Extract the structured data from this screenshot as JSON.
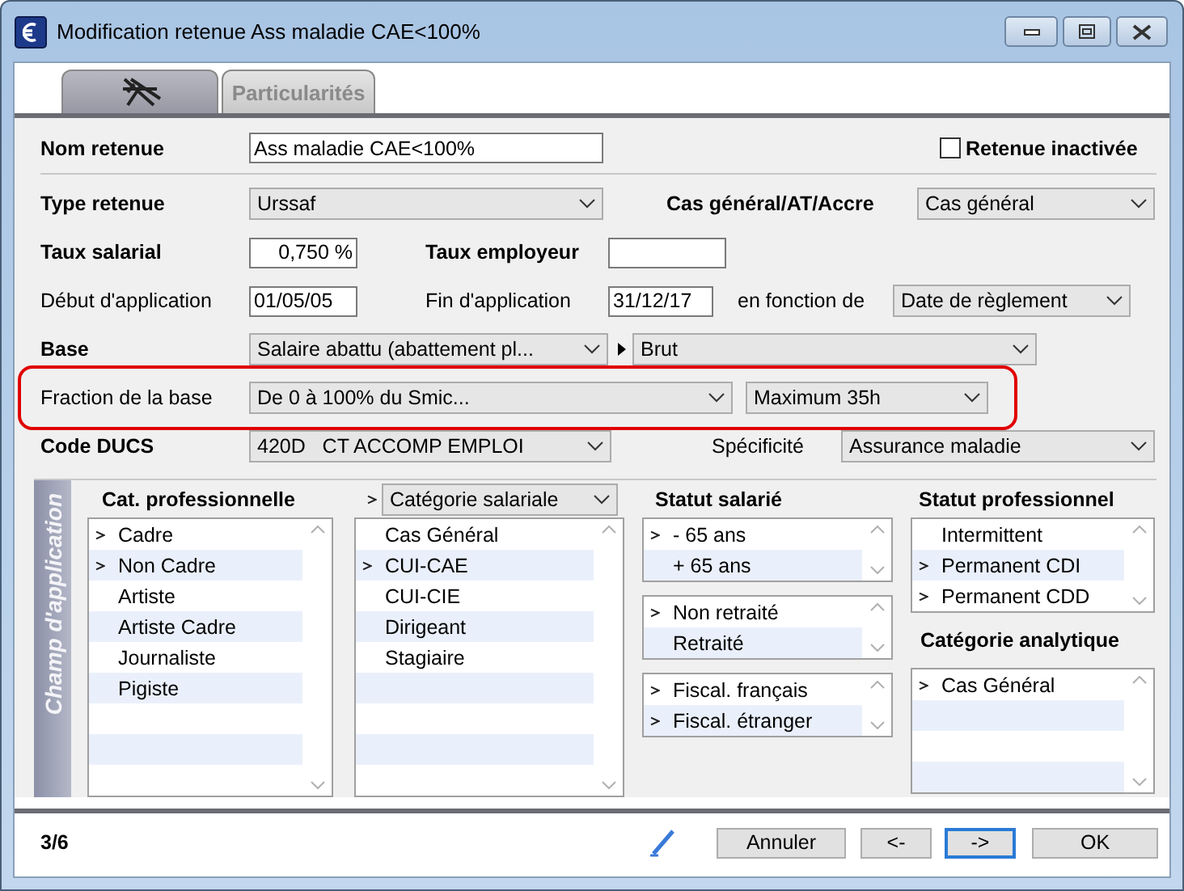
{
  "window": {
    "title": "Modification retenue Ass maladie CAE<100%"
  },
  "tabs": [
    {
      "kind": "icon",
      "selected": true
    },
    {
      "kind": "text",
      "label": "Particularités",
      "selected": false
    }
  ],
  "form": {
    "nom_retenue": {
      "label": "Nom retenue",
      "value": "Ass maladie CAE<100%"
    },
    "retenue_inactivee": {
      "label": "Retenue inactivée",
      "checked": false
    },
    "type_retenue": {
      "label": "Type retenue",
      "value": "Urssaf"
    },
    "cas_general": {
      "label": "Cas général/AT/Accre",
      "value": "Cas général"
    },
    "taux_salarial": {
      "label": "Taux salarial",
      "value": "0,750 %"
    },
    "taux_employeur": {
      "label": "Taux employeur"
    },
    "debut": {
      "label": "Début d'application",
      "value": "01/05/05"
    },
    "fin": {
      "label": "Fin d'application",
      "value": "31/12/17"
    },
    "en_fonction_de": {
      "label": "en fonction de",
      "value": "Date de règlement"
    },
    "base": {
      "label": "Base",
      "value": "Salaire abattu (abattement pl...",
      "value_2": "Brut"
    },
    "fraction": {
      "label": "Fraction de la base",
      "value": "De 0 à 100% du Smic...",
      "value_2": "Maximum 35h",
      "highlighted": true
    },
    "code_ducs": {
      "label": "Code DUCS",
      "value": "420D   CT ACCOMP EMPLOI"
    },
    "specificite": {
      "label": "Spécificité",
      "value": "Assurance maladie"
    }
  },
  "champ_application": {
    "title": "Champ d'application",
    "cat_professionnelle": {
      "title": "Cat. professionnelle",
      "items": [
        {
          "label": "Cadre",
          "checked": true
        },
        {
          "label": "Non Cadre",
          "checked": true
        },
        {
          "label": "Artiste",
          "checked": false
        },
        {
          "label": "Artiste Cadre",
          "checked": false
        },
        {
          "label": "Journaliste",
          "checked": false
        },
        {
          "label": "Pigiste",
          "checked": false
        }
      ]
    },
    "categorie": {
      "value": "Catégorie salariale",
      "items": [
        {
          "label": "Cas Général",
          "checked": false
        },
        {
          "label": "CUI-CAE",
          "checked": true
        },
        {
          "label": "CUI-CIE",
          "checked": false
        },
        {
          "label": "Dirigeant",
          "checked": false
        },
        {
          "label": "Stagiaire",
          "checked": false
        }
      ]
    },
    "statut_salarie": {
      "title": "Statut salarié",
      "lists": [
        {
          "items": [
            {
              "label": "- 65 ans",
              "checked": true
            },
            {
              "label": "+ 65 ans",
              "checked": false
            }
          ]
        },
        {
          "items": [
            {
              "label": "Non retraité",
              "checked": true
            },
            {
              "label": "Retraité",
              "checked": false
            }
          ]
        },
        {
          "items": [
            {
              "label": "Fiscal. français",
              "checked": true
            },
            {
              "label": "Fiscal. étranger",
              "checked": true
            }
          ]
        }
      ]
    },
    "statut_professionnel": {
      "title": "Statut professionnel",
      "items": [
        {
          "label": "Intermittent",
          "checked": false
        },
        {
          "label": "Permanent CDI",
          "checked": true
        },
        {
          "label": "Permanent CDD",
          "checked": true
        }
      ]
    },
    "categorie_analytique": {
      "title": "Catégorie analytique",
      "items": [
        {
          "label": "Cas Général",
          "checked": true
        }
      ]
    }
  },
  "footer": {
    "page": "3/6",
    "buttons": [
      {
        "label": "Annuler",
        "focused": false
      },
      {
        "label": "<-",
        "focused": false
      },
      {
        "label": "->",
        "focused": true
      },
      {
        "label": "OK",
        "focused": false
      }
    ]
  }
}
